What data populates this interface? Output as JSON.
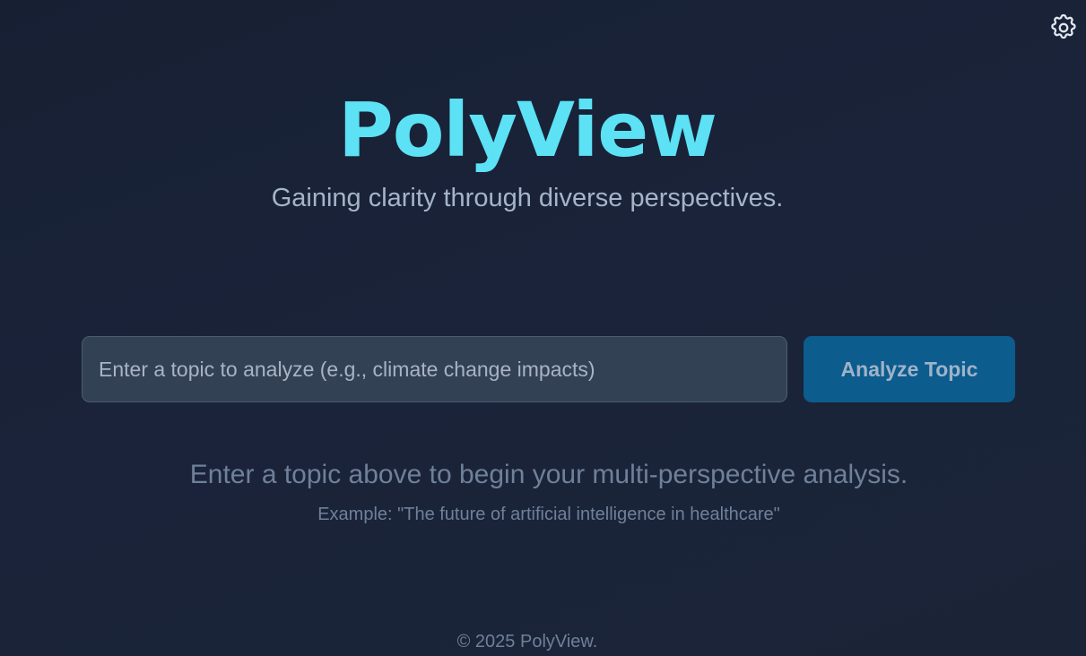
{
  "settings": {
    "icon": "gear-icon",
    "color": "#e2e8f0"
  },
  "header": {
    "title": "PolyView",
    "subtitle": "Gaining clarity through diverse perspectives.",
    "title_color": "#5ce1f5"
  },
  "search": {
    "placeholder": "Enter a topic to analyze (e.g., climate change impacts)",
    "value": "",
    "button_label": "Analyze Topic",
    "button_color": "#0c5c8e"
  },
  "empty_state": {
    "message": "Enter a topic above to begin your multi-perspective analysis.",
    "example": "Example: \"The future of artificial intelligence in healthcare\""
  },
  "footer": {
    "copyright": "© 2025 PolyView."
  }
}
